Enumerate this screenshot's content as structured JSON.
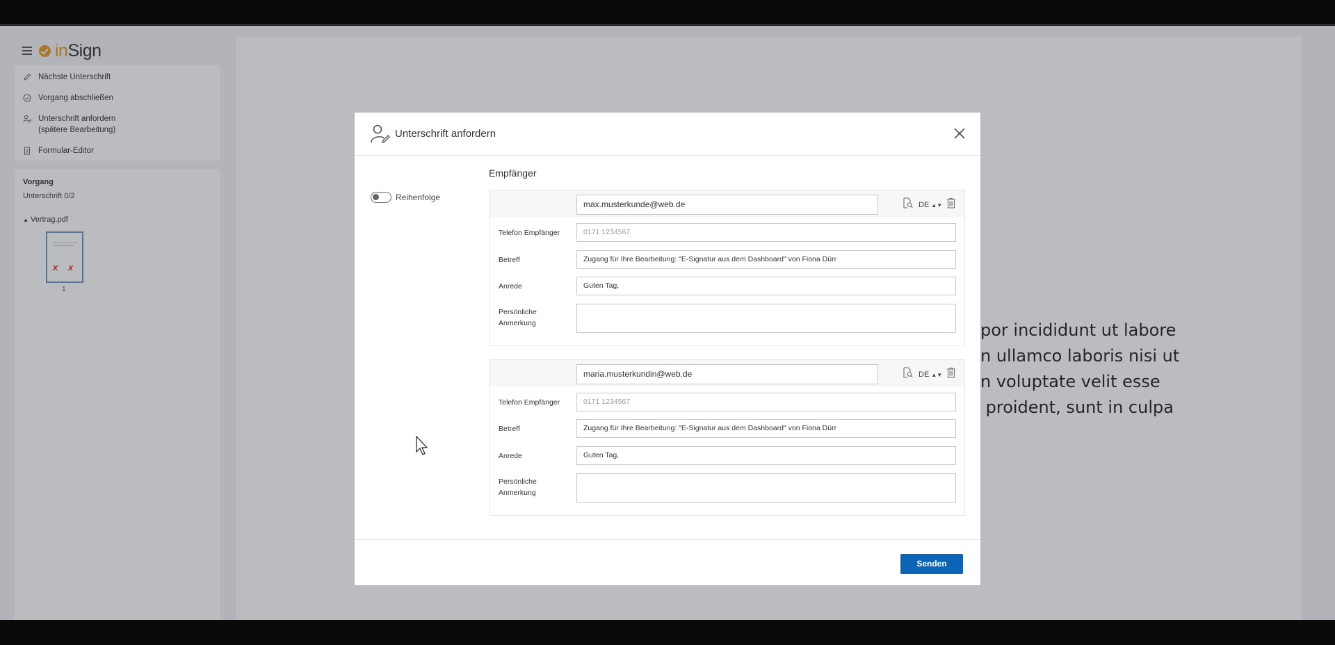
{
  "app": {
    "logo_prefix": "in",
    "logo_suffix": "Sign"
  },
  "sidebar": {
    "menu": [
      {
        "label": "Nächste Unterschrift",
        "icon": "pen-icon"
      },
      {
        "label": "Vorgang abschließen",
        "icon": "check-circle-icon"
      },
      {
        "label": "Unterschrift anfordern",
        "label2": "(spätere Bearbeitung)",
        "icon": "user-pen-icon"
      },
      {
        "label": "Formular-Editor",
        "icon": "document-icon"
      }
    ],
    "vorgang": {
      "title": "Vorgang",
      "count": "Unterschrift 0/2",
      "file": "Vertrag.pdf",
      "page": "1"
    }
  },
  "document": {
    "lines": [
      "por incididunt ut labore",
      "n ullamco laboris nisi ut",
      "n voluptate velit esse",
      " proident, sunt in culpa"
    ]
  },
  "modal": {
    "title": "Unterschrift anfordern",
    "order_toggle_label": "Reihenfolge",
    "order_toggle_on": false,
    "section_title": "Empfänger",
    "labels": {
      "phone": "Telefon Empfänger",
      "subject": "Betreff",
      "salutation": "Anrede",
      "note_line1": "Persönliche",
      "note_line2": "Anmerkung"
    },
    "recipients": [
      {
        "email": "max.musterkunde@web.de",
        "language": "DE",
        "phone_placeholder": "0171 1234567",
        "subject": "Zugang für Ihre Bearbeitung: \"E-Signatur aus dem Dashboard\" von Fiona Dürr",
        "salutation": "Guten Tag,",
        "note": ""
      },
      {
        "email": "maria.musterkundin@web.de",
        "language": "DE",
        "phone_placeholder": "0171 1234567",
        "subject": "Zugang für Ihre Bearbeitung: \"E-Signatur aus dem Dashboard\" von Fiona Dürr",
        "salutation": "Guten Tag,",
        "note": ""
      }
    ],
    "send_label": "Senden"
  },
  "colors": {
    "accent": "#0c64b7",
    "logo_orange": "#e59a1e"
  }
}
